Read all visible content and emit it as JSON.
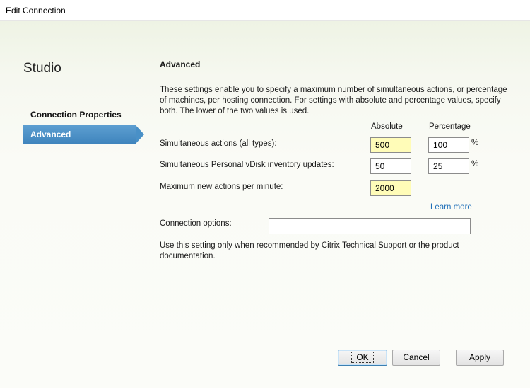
{
  "window": {
    "title": "Edit Connection"
  },
  "sidebar": {
    "brand": "Studio",
    "items": [
      {
        "label": "Connection Properties",
        "active": false
      },
      {
        "label": "Advanced",
        "active": true
      }
    ]
  },
  "main": {
    "section_title": "Advanced",
    "description": "These settings enable you to specify a maximum number of simultaneous actions, or percentage of machines, per hosting connection. For settings with absolute and percentage values, specify both. The lower of the two values is used.",
    "columns": {
      "absolute": "Absolute",
      "percentage": "Percentage"
    },
    "rows": [
      {
        "label": "Simultaneous actions (all types):",
        "absolute": "500",
        "percentage": "100",
        "unit": "%"
      },
      {
        "label": "Simultaneous Personal vDisk inventory updates:",
        "absolute": "50",
        "percentage": "25",
        "unit": "%"
      },
      {
        "label": "Maximum new actions per minute:",
        "absolute": "2000"
      }
    ],
    "learn_more": "Learn more",
    "connection_options": {
      "label": "Connection options:",
      "value": ""
    },
    "note": "Use this setting only when recommended by Citrix Technical Support or the product documentation."
  },
  "buttons": {
    "ok": "OK",
    "cancel": "Cancel",
    "apply": "Apply"
  },
  "colors": {
    "active_nav": "#4990c7",
    "highlight_field": "#fffcb8",
    "link": "#1f6fb8"
  }
}
